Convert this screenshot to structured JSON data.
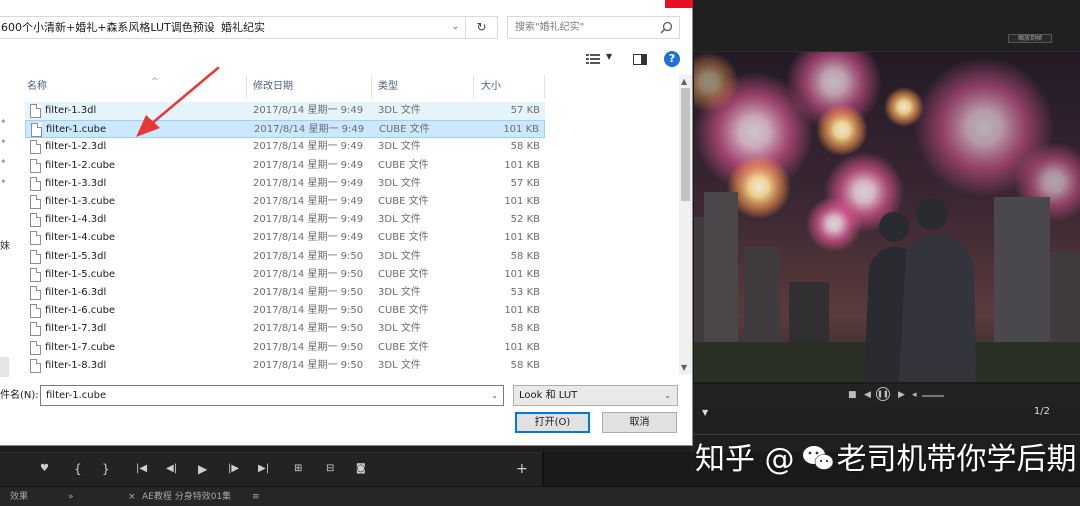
{
  "dialog": {
    "breadcrumb": [
      "600个小清新+婚礼+森系风格LUT调色预设",
      "婚礼纪实"
    ],
    "search_placeholder": "搜索\"婚礼纪实\"",
    "columns": {
      "name": "名称",
      "date": "修改日期",
      "type": "类型",
      "size": "大小"
    },
    "nav_label": "妹",
    "files": [
      {
        "name": "filter-1.3dl",
        "date": "2017/8/14 星期一 9:49",
        "type": "3DL 文件",
        "size": "57 KB"
      },
      {
        "name": "filter-1.cube",
        "date": "2017/8/14 星期一 9:49",
        "type": "CUBE 文件",
        "size": "101 KB"
      },
      {
        "name": "filter-1-2.3dl",
        "date": "2017/8/14 星期一 9:49",
        "type": "3DL 文件",
        "size": "58 KB"
      },
      {
        "name": "filter-1-2.cube",
        "date": "2017/8/14 星期一 9:49",
        "type": "CUBE 文件",
        "size": "101 KB"
      },
      {
        "name": "filter-1-3.3dl",
        "date": "2017/8/14 星期一 9:49",
        "type": "3DL 文件",
        "size": "57 KB"
      },
      {
        "name": "filter-1-3.cube",
        "date": "2017/8/14 星期一 9:49",
        "type": "CUBE 文件",
        "size": "101 KB"
      },
      {
        "name": "filter-1-4.3dl",
        "date": "2017/8/14 星期一 9:49",
        "type": "3DL 文件",
        "size": "52 KB"
      },
      {
        "name": "filter-1-4.cube",
        "date": "2017/8/14 星期一 9:49",
        "type": "CUBE 文件",
        "size": "101 KB"
      },
      {
        "name": "filter-1-5.3dl",
        "date": "2017/8/14 星期一 9:50",
        "type": "3DL 文件",
        "size": "58 KB"
      },
      {
        "name": "filter-1-5.cube",
        "date": "2017/8/14 星期一 9:50",
        "type": "CUBE 文件",
        "size": "101 KB"
      },
      {
        "name": "filter-1-6.3dl",
        "date": "2017/8/14 星期一 9:50",
        "type": "3DL 文件",
        "size": "53 KB"
      },
      {
        "name": "filter-1-6.cube",
        "date": "2017/8/14 星期一 9:50",
        "type": "CUBE 文件",
        "size": "101 KB"
      },
      {
        "name": "filter-1-7.3dl",
        "date": "2017/8/14 星期一 9:50",
        "type": "3DL 文件",
        "size": "58 KB"
      },
      {
        "name": "filter-1-7.cube",
        "date": "2017/8/14 星期一 9:50",
        "type": "CUBE 文件",
        "size": "101 KB"
      },
      {
        "name": "filter-1-8.3dl",
        "date": "2017/8/14 星期一 9:50",
        "type": "3DL 文件",
        "size": "58 KB"
      }
    ],
    "selected_index": 1,
    "filename_label": "件名(N):",
    "filename_value": "filter-1.cube",
    "filetype_value": "Look 和 LUT",
    "open_label": "打开(O)",
    "cancel_label": "取消",
    "colors": {
      "selection": "#cce8ff",
      "hover": "#e5f3fb",
      "arrow": "#e53935",
      "close": "#e81123"
    },
    "icons": [
      "chevron-down-icon",
      "refresh-icon",
      "search-icon",
      "view-list-icon",
      "preview-pane-icon",
      "help-icon",
      "file-icon",
      "pin-icon"
    ]
  },
  "video": {
    "page_indicator": "1/2",
    "mini_label": "缩放到帧",
    "scene": "fireworks-over-city-couple",
    "icons": [
      "stop-icon",
      "play-icon",
      "next-frame-icon",
      "volume-icon"
    ]
  },
  "bottom": {
    "toolbar_icons": [
      "marker-icon",
      "in-point-icon",
      "out-point-icon",
      "go-to-in-icon",
      "step-back-icon",
      "play-icon",
      "step-forward-icon",
      "go-to-out-icon",
      "insert-icon",
      "overwrite-icon",
      "export-frame-icon",
      "add-icon"
    ],
    "tabs": {
      "effects": "效果",
      "sequence_tab": "AE教程 分身特效01集"
    }
  },
  "watermark": {
    "text_left": "知乎 @",
    "text_right": "老司机带你学后期"
  }
}
